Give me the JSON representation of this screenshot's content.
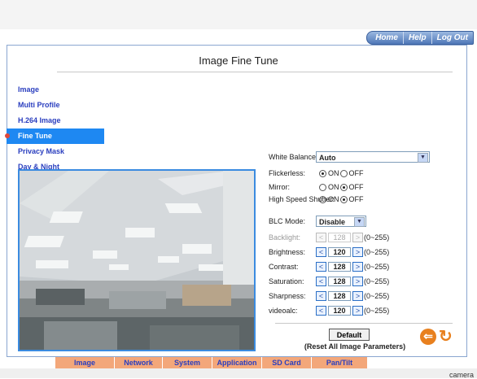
{
  "topnav": [
    "Home",
    "Help",
    "Log Out"
  ],
  "page_title": "Image Fine Tune",
  "menu": [
    {
      "label": "Image",
      "active": false
    },
    {
      "label": "Multi Profile",
      "active": false
    },
    {
      "label": "H.264 Image",
      "active": false
    },
    {
      "label": "Fine Tune",
      "active": true
    },
    {
      "label": "Privacy Mask",
      "active": false
    },
    {
      "label": "Day & Night",
      "active": false
    }
  ],
  "form": {
    "white_balance": {
      "label": "White Balance:",
      "value": "Auto"
    },
    "flickerless": {
      "label": "Flickerless:",
      "on": "ON",
      "off": "OFF",
      "selected": "ON"
    },
    "mirror": {
      "label": "Mirror:",
      "on": "ON",
      "off": "OFF",
      "selected": "OFF"
    },
    "high_speed_shutter": {
      "label": "High Speed Shutter:",
      "on": "ON",
      "off": "OFF",
      "selected": "OFF"
    },
    "blc_mode": {
      "label": "BLC Mode:",
      "value": "Disable"
    },
    "sliders": [
      {
        "label": "Backlight:",
        "value": "128",
        "range": "(0~255)",
        "disabled": true
      },
      {
        "label": "Brightness:",
        "value": "120",
        "range": "(0~255)",
        "disabled": false
      },
      {
        "label": "Contrast:",
        "value": "128",
        "range": "(0~255)",
        "disabled": false
      },
      {
        "label": "Saturation:",
        "value": "128",
        "range": "(0~255)",
        "disabled": false
      },
      {
        "label": "Sharpness:",
        "value": "128",
        "range": "(0~255)",
        "disabled": false
      },
      {
        "label": "videoalc:",
        "value": "120",
        "range": "(0~255)",
        "disabled": false
      }
    ],
    "decrement_symbol": "<",
    "increment_symbol": ">"
  },
  "default_button": "Default",
  "reset_text": "(Reset All Image Parameters)",
  "bottom_nav": [
    "Image",
    "Network",
    "System",
    "Application",
    "SD Card",
    "Pan/Tilt"
  ],
  "footer_text": "camera",
  "colors": {
    "accent_blue": "#1e88f2",
    "nav_orange": "#f3a77a",
    "back_orange": "#e8801e"
  },
  "icons": {
    "back": "back-arrow-icon",
    "refresh": "refresh-icon"
  }
}
